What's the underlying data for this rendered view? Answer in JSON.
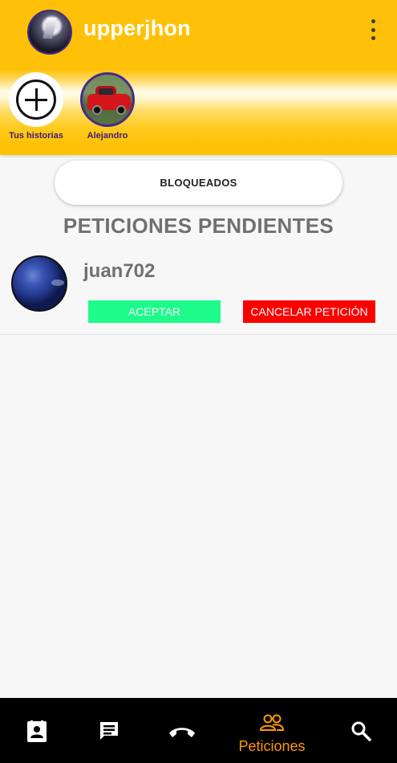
{
  "header": {
    "username": "upperjhon"
  },
  "stories": [
    {
      "label": "Tus historias"
    },
    {
      "label": "Alejandro"
    }
  ],
  "blocked_button": {
    "label": "BLOQUEADOS"
  },
  "section": {
    "title": "PETICIONES PENDIENTES"
  },
  "requests": [
    {
      "username": "juan702",
      "accept_label": "ACEPTAR",
      "cancel_label": "CANCELAR PETICIÓN"
    }
  ],
  "bottom_nav": {
    "items": [
      {
        "icon": "contact-icon",
        "label": ""
      },
      {
        "icon": "chat-icon",
        "label": ""
      },
      {
        "icon": "phone-icon",
        "label": ""
      },
      {
        "icon": "people-icon",
        "label": "Peticiones",
        "active": true
      },
      {
        "icon": "search-icon",
        "label": ""
      }
    ]
  },
  "colors": {
    "header": "#ffc107",
    "accent": "#ff9800",
    "accept": "#1dfc8a",
    "cancel": "#fc0000",
    "story_label": "#3a1d78"
  }
}
